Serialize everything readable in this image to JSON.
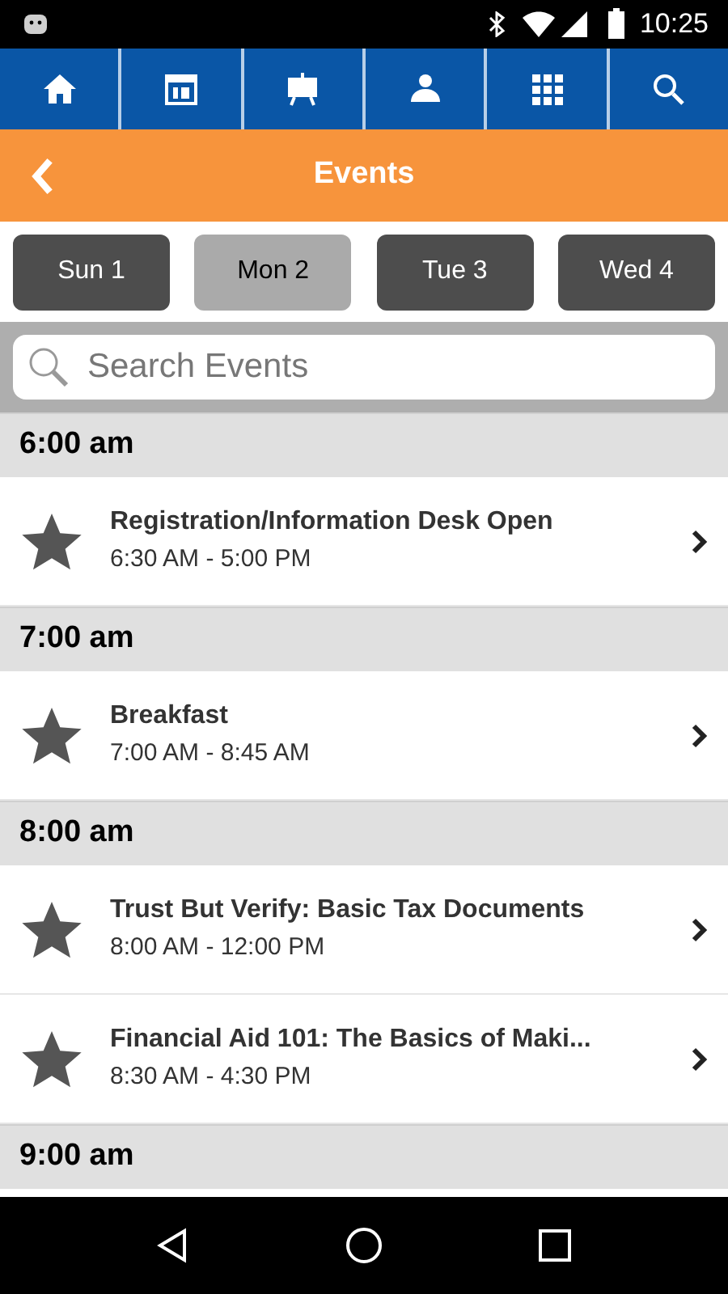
{
  "status_bar": {
    "time": "10:25"
  },
  "header": {
    "title": "Events"
  },
  "days": [
    {
      "label": "Sun 1",
      "selected": false
    },
    {
      "label": "Mon 2",
      "selected": true
    },
    {
      "label": "Tue 3",
      "selected": false
    },
    {
      "label": "Wed 4",
      "selected": false
    }
  ],
  "search": {
    "placeholder": "Search Events"
  },
  "sections": [
    {
      "time": "6:00 am",
      "events": [
        {
          "title": "Registration/Information Desk Open",
          "time": "6:30 AM - 5:00 PM"
        }
      ]
    },
    {
      "time": "7:00 am",
      "events": [
        {
          "title": "Breakfast",
          "time": "7:00 AM - 8:45 AM"
        }
      ]
    },
    {
      "time": "8:00 am",
      "events": [
        {
          "title": "Trust But Verify: Basic Tax Documents",
          "time": "8:00 AM - 12:00 PM"
        },
        {
          "title": "Financial Aid 101: The Basics of Maki...",
          "time": "8:30 AM - 4:30 PM"
        }
      ]
    },
    {
      "time": "9:00 am"
    }
  ]
}
